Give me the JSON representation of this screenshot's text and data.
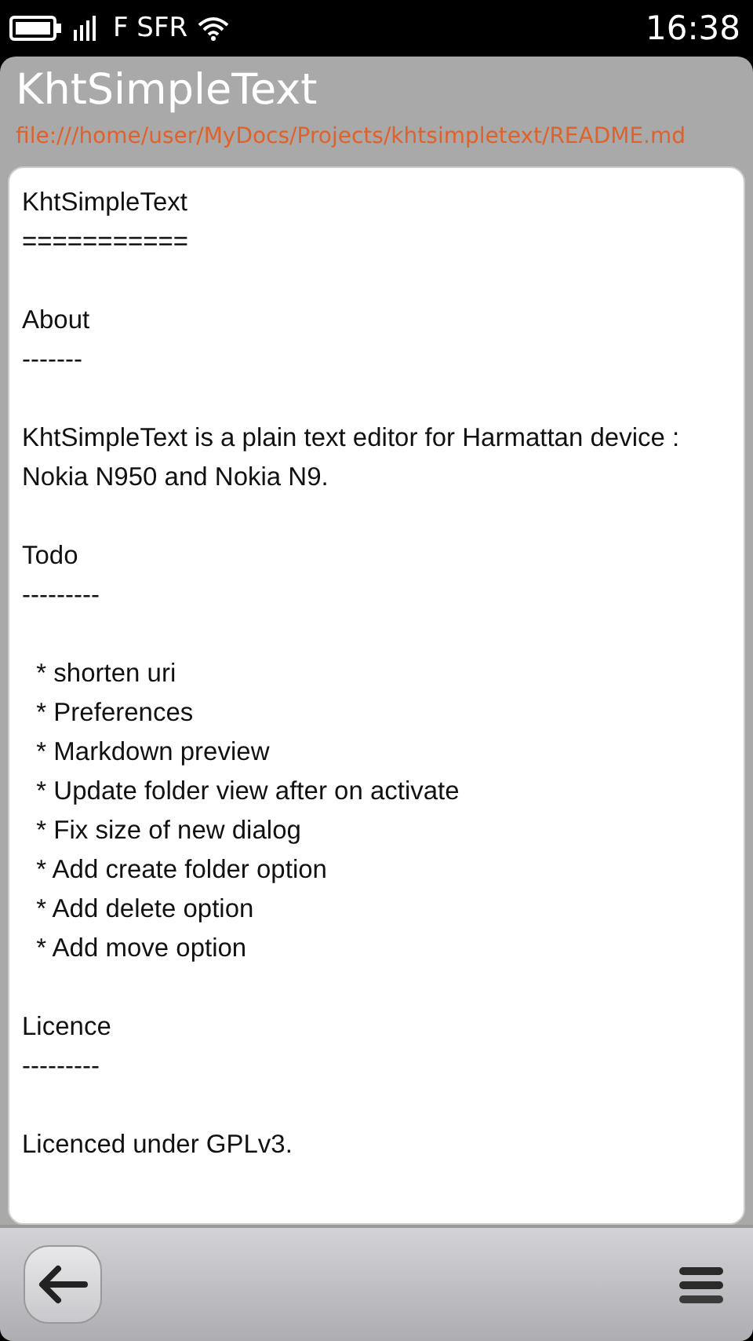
{
  "status_bar": {
    "carrier": "F SFR",
    "time": "16:38"
  },
  "header": {
    "title": "KhtSimpleText",
    "path": "file:///home/user/MyDocs/Projects/khtsimpletext/README.md"
  },
  "editor": {
    "value": "KhtSimpleText\n===========\n\nAbout\n-------\n\nKhtSimpleText is a plain text editor for Harmattan device : Nokia N950 and Nokia N9.\n\nTodo\n---------\n\n  * shorten uri\n  * Preferences\n  * Markdown preview\n  * Update folder view after on activate\n  * Fix size of new dialog\n  * Add create folder option\n  * Add delete option\n  * Add move option\n\nLicence\n---------\n\nLicenced under GPLv3."
  }
}
